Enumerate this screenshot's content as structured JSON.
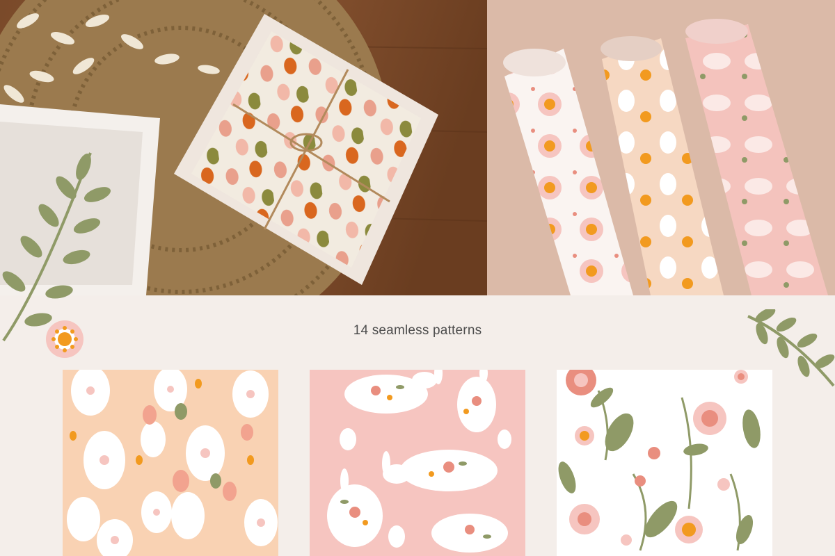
{
  "caption": "14 seamless patterns",
  "palette": {
    "background": "#f4eeea",
    "peach": "#f9d2b3",
    "pink": "#f6c5c0",
    "coral": "#e98e7f",
    "orange": "#f29a1f",
    "olive": "#8f9a67",
    "white": "#ffffff"
  },
  "images": [
    {
      "name": "gift-box-photo",
      "description": "wrapped gift box with egg pattern on wooden table"
    },
    {
      "name": "fabric-rolls-photo",
      "description": "three rolled fabrics with easter patterns"
    },
    {
      "name": "egg-pattern-swatch"
    },
    {
      "name": "bunny-pattern-swatch"
    },
    {
      "name": "flower-pattern-swatch"
    }
  ]
}
